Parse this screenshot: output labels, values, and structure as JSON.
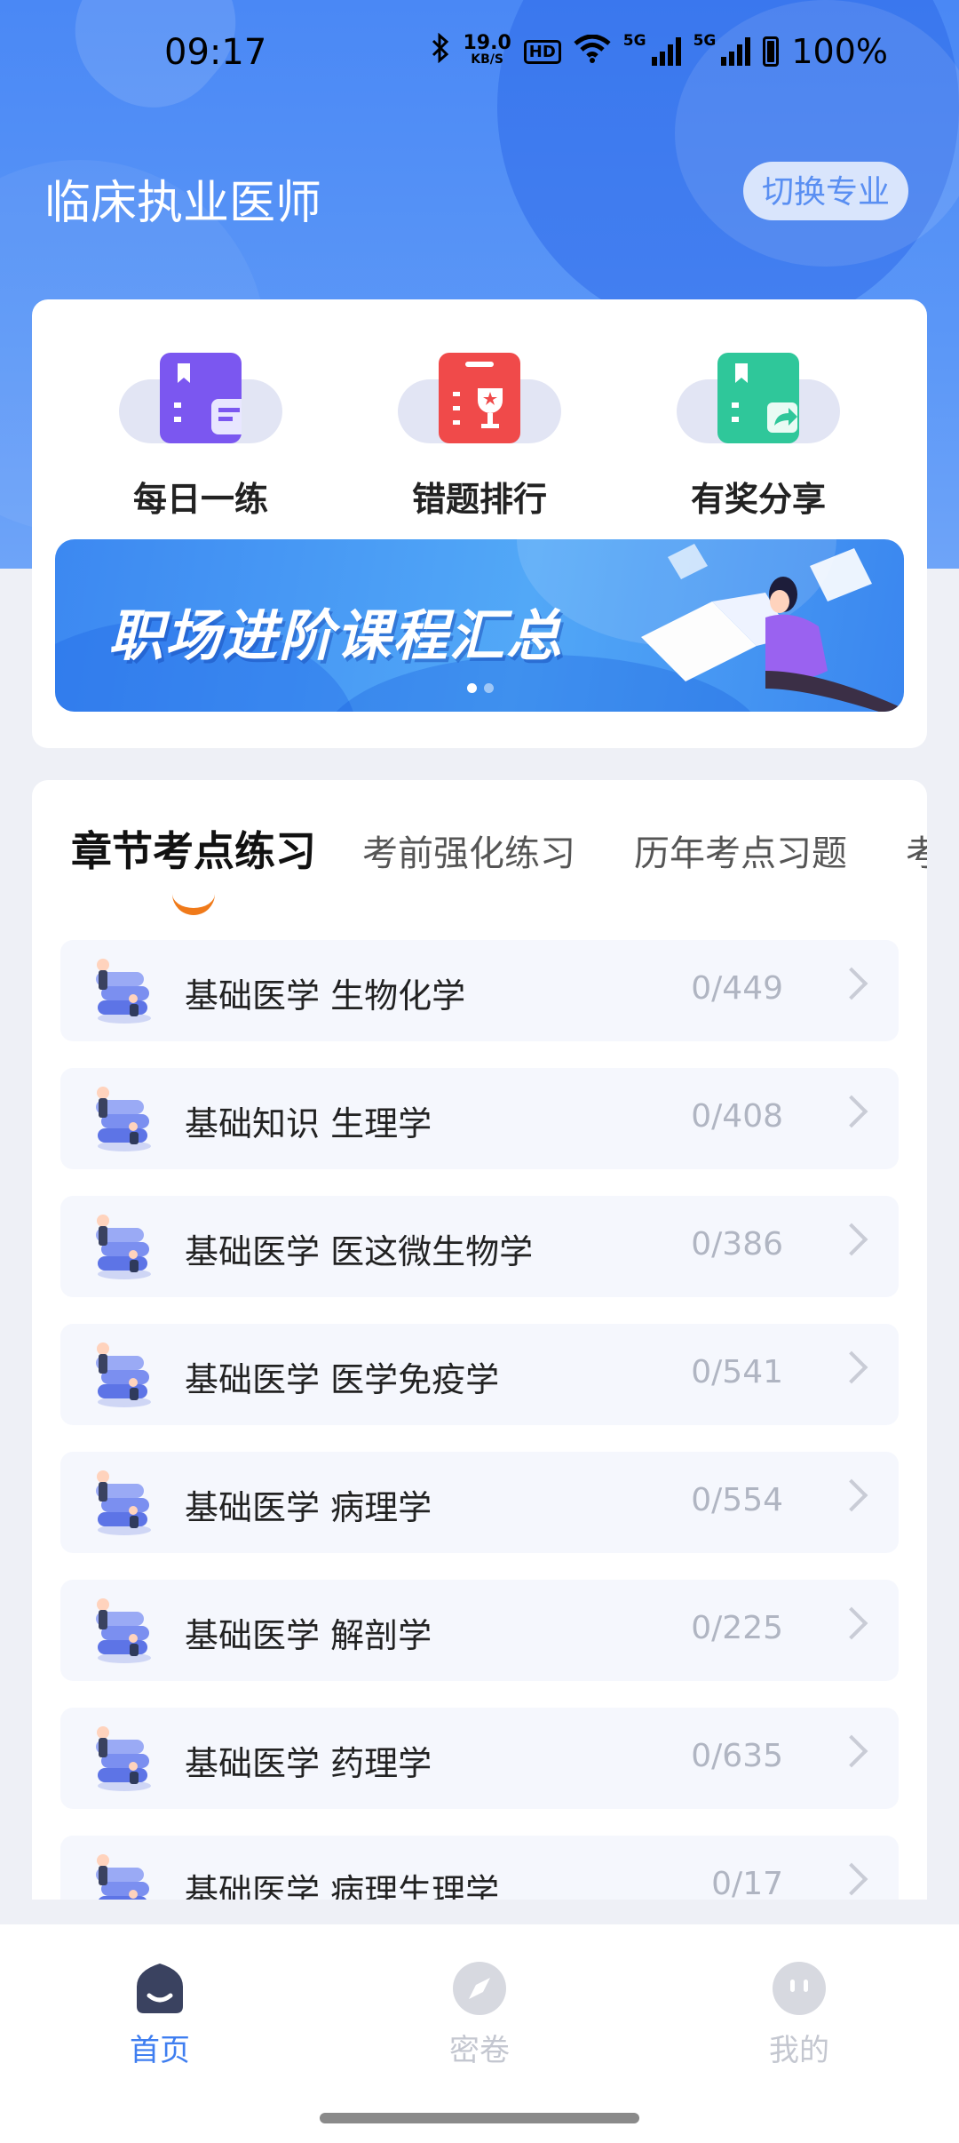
{
  "status_bar": {
    "time": "09:17",
    "net_speed_value": "19.0",
    "net_speed_unit": "KB/S",
    "hd_label": "HD",
    "sim1_label": "5G",
    "sim2_label": "5G",
    "battery": "100%"
  },
  "header": {
    "title": "临床执业医师",
    "switch_label": "切换专业"
  },
  "quick_actions": [
    {
      "label": "每日一练",
      "icon": "daily-practice-book-icon",
      "color": "#7b57f0"
    },
    {
      "label": "错题排行",
      "icon": "wrong-question-ranking-icon",
      "color": "#f04a4a"
    },
    {
      "label": "有奖分享",
      "icon": "reward-share-icon",
      "color": "#2fc79a"
    }
  ],
  "banner": {
    "text": "职场进阶课程汇总",
    "active_slide": 1,
    "slide_count": 2
  },
  "tabs": [
    {
      "label": "章节考点练习",
      "active": true
    },
    {
      "label": "考前强化练习",
      "active": false
    },
    {
      "label": "历年考点习题",
      "active": false
    },
    {
      "label": "考",
      "active": false
    }
  ],
  "chapters": [
    {
      "label": "基础医学 生物化学",
      "count": "0/449"
    },
    {
      "label": "基础知识 生理学",
      "count": "0/408"
    },
    {
      "label": "基础医学 医这微生物学",
      "count": "0/386"
    },
    {
      "label": "基础医学 医学免疫学",
      "count": "0/541"
    },
    {
      "label": "基础医学 病理学",
      "count": "0/554"
    },
    {
      "label": "基础医学 解剖学",
      "count": "0/225"
    },
    {
      "label": "基础医学 药理学",
      "count": "0/635"
    },
    {
      "label": "基础医学 病理生理学",
      "count": "0/17"
    }
  ],
  "bottom_nav": [
    {
      "label": "首页",
      "icon": "home-icon",
      "active": true
    },
    {
      "label": "密卷",
      "icon": "compass-icon",
      "active": false
    },
    {
      "label": "我的",
      "icon": "profile-face-icon",
      "active": false
    }
  ],
  "colors": {
    "brand_blue": "#3f7ef0",
    "tab_underline": "#f07a1a",
    "count_gray": "#b0b5c2"
  }
}
